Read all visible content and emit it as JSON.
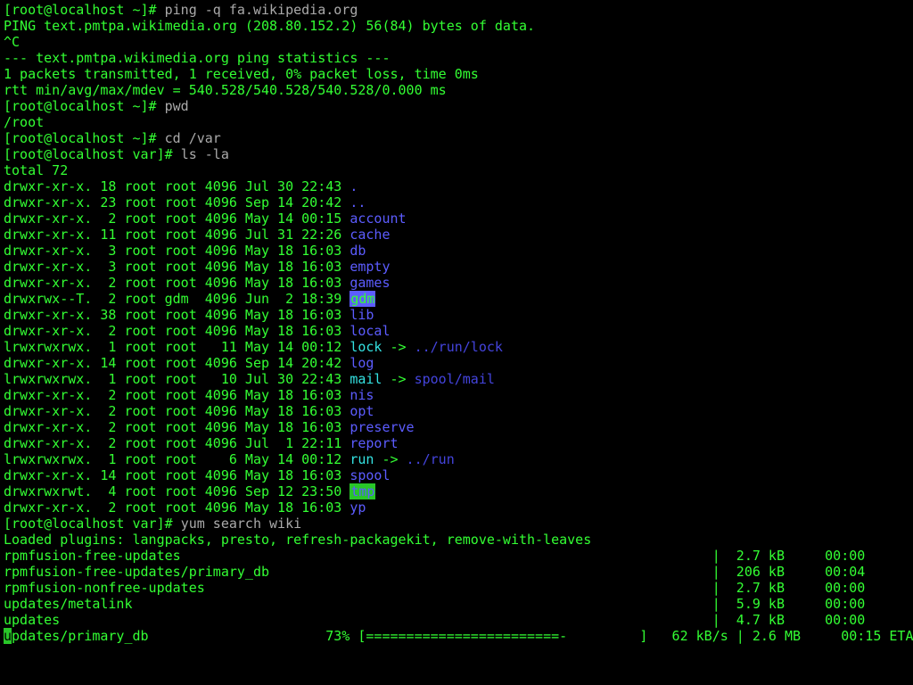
{
  "prompt": {
    "user": "root",
    "host": "localhost",
    "home": "~",
    "var": "var"
  },
  "cmd": {
    "ping": "ping -q fa.wikipedia.org",
    "pwd": "pwd",
    "cd": "cd /var",
    "ls": "ls -la",
    "yum": "yum search wiki"
  },
  "ping": {
    "header": "PING text.pmtpa.wikimedia.org (208.80.152.2) 56(84) bytes of data.",
    "abort": "^C",
    "stats_title": "--- text.pmtpa.wikimedia.org ping statistics ---",
    "stats_line1": "1 packets transmitted, 1 received, 0% packet loss, time 0ms",
    "stats_line2": "rtt min/avg/max/mdev = 540.528/540.528/540.528/0.000 ms"
  },
  "pwd_out": "/root",
  "ls_total": "total 72",
  "ls_rows": [
    {
      "perm": "drwxr-xr-x.",
      "links": "18",
      "own": "root root",
      "size": "4096",
      "date": "Jul 30 22:43",
      "name": ".",
      "style": "blue"
    },
    {
      "perm": "drwxr-xr-x.",
      "links": "23",
      "own": "root root",
      "size": "4096",
      "date": "Sep 14 20:42",
      "name": "..",
      "style": "blue"
    },
    {
      "perm": "drwxr-xr-x.",
      "links": " 2",
      "own": "root root",
      "size": "4096",
      "date": "May 14 00:15",
      "name": "account",
      "style": "blue"
    },
    {
      "perm": "drwxr-xr-x.",
      "links": "11",
      "own": "root root",
      "size": "4096",
      "date": "Jul 31 22:26",
      "name": "cache",
      "style": "blue"
    },
    {
      "perm": "drwxr-xr-x.",
      "links": " 3",
      "own": "root root",
      "size": "4096",
      "date": "May 18 16:03",
      "name": "db",
      "style": "blue"
    },
    {
      "perm": "drwxr-xr-x.",
      "links": " 3",
      "own": "root root",
      "size": "4096",
      "date": "May 18 16:03",
      "name": "empty",
      "style": "blue"
    },
    {
      "perm": "drwxr-xr-x.",
      "links": " 2",
      "own": "root root",
      "size": "4096",
      "date": "May 18 16:03",
      "name": "games",
      "style": "blue"
    },
    {
      "perm": "drwxrwx--T.",
      "links": " 2",
      "own": "root gdm ",
      "size": "4096",
      "date": "Jun  2 18:39",
      "name": "gdm",
      "style": "hl-blue-bg"
    },
    {
      "perm": "drwxr-xr-x.",
      "links": "38",
      "own": "root root",
      "size": "4096",
      "date": "May 18 16:03",
      "name": "lib",
      "style": "blue"
    },
    {
      "perm": "drwxr-xr-x.",
      "links": " 2",
      "own": "root root",
      "size": "4096",
      "date": "May 18 16:03",
      "name": "local",
      "style": "blue"
    },
    {
      "perm": "lrwxrwxrwx.",
      "links": " 1",
      "own": "root root",
      "size": "  11",
      "date": "May 14 00:12",
      "name": "lock",
      "style": "cyan",
      "target": "../run/lock"
    },
    {
      "perm": "drwxr-xr-x.",
      "links": "14",
      "own": "root root",
      "size": "4096",
      "date": "Sep 14 20:42",
      "name": "log",
      "style": "blue"
    },
    {
      "perm": "lrwxrwxrwx.",
      "links": " 1",
      "own": "root root",
      "size": "  10",
      "date": "Jul 30 22:43",
      "name": "mail",
      "style": "cyan",
      "target": "spool/mail"
    },
    {
      "perm": "drwxr-xr-x.",
      "links": " 2",
      "own": "root root",
      "size": "4096",
      "date": "May 18 16:03",
      "name": "nis",
      "style": "blue"
    },
    {
      "perm": "drwxr-xr-x.",
      "links": " 2",
      "own": "root root",
      "size": "4096",
      "date": "May 18 16:03",
      "name": "opt",
      "style": "blue"
    },
    {
      "perm": "drwxr-xr-x.",
      "links": " 2",
      "own": "root root",
      "size": "4096",
      "date": "May 18 16:03",
      "name": "preserve",
      "style": "blue"
    },
    {
      "perm": "drwxr-xr-x.",
      "links": " 2",
      "own": "root root",
      "size": "4096",
      "date": "Jul  1 22:11",
      "name": "report",
      "style": "blue"
    },
    {
      "perm": "lrwxrwxrwx.",
      "links": " 1",
      "own": "root root",
      "size": "   6",
      "date": "May 14 00:12",
      "name": "run",
      "style": "cyan",
      "target": "../run"
    },
    {
      "perm": "drwxr-xr-x.",
      "links": "14",
      "own": "root root",
      "size": "4096",
      "date": "May 18 16:03",
      "name": "spool",
      "style": "blue"
    },
    {
      "perm": "drwxrwxrwt.",
      "links": " 4",
      "own": "root root",
      "size": "4096",
      "date": "Sep 12 23:50",
      "name": "tmp",
      "style": "hl-green-bg"
    },
    {
      "perm": "drwxr-xr-x.",
      "links": " 2",
      "own": "root root",
      "size": "4096",
      "date": "May 18 16:03",
      "name": "yp",
      "style": "blue"
    }
  ],
  "yum": {
    "plugins": "Loaded plugins: langpacks, presto, refresh-packagekit, remove-with-leaves",
    "repos": [
      {
        "name": "rpmfusion-free-updates",
        "size": "2.7 kB",
        "time": "00:00"
      },
      {
        "name": "rpmfusion-free-updates/primary_db",
        "size": "206 kB",
        "time": "00:04"
      },
      {
        "name": "rpmfusion-nonfree-updates",
        "size": "2.7 kB",
        "time": "00:00"
      },
      {
        "name": "updates/metalink",
        "size": "5.9 kB",
        "time": "00:00"
      },
      {
        "name": "updates",
        "size": "4.7 kB",
        "time": "00:00"
      }
    ],
    "progress": {
      "name_first": "u",
      "name_rest": "pdates/primary_db",
      "percent": "73%",
      "bar": "[========================-         ]",
      "rate": "62 kB/s",
      "size": "2.6 MB",
      "eta": "00:15 ETA"
    }
  }
}
